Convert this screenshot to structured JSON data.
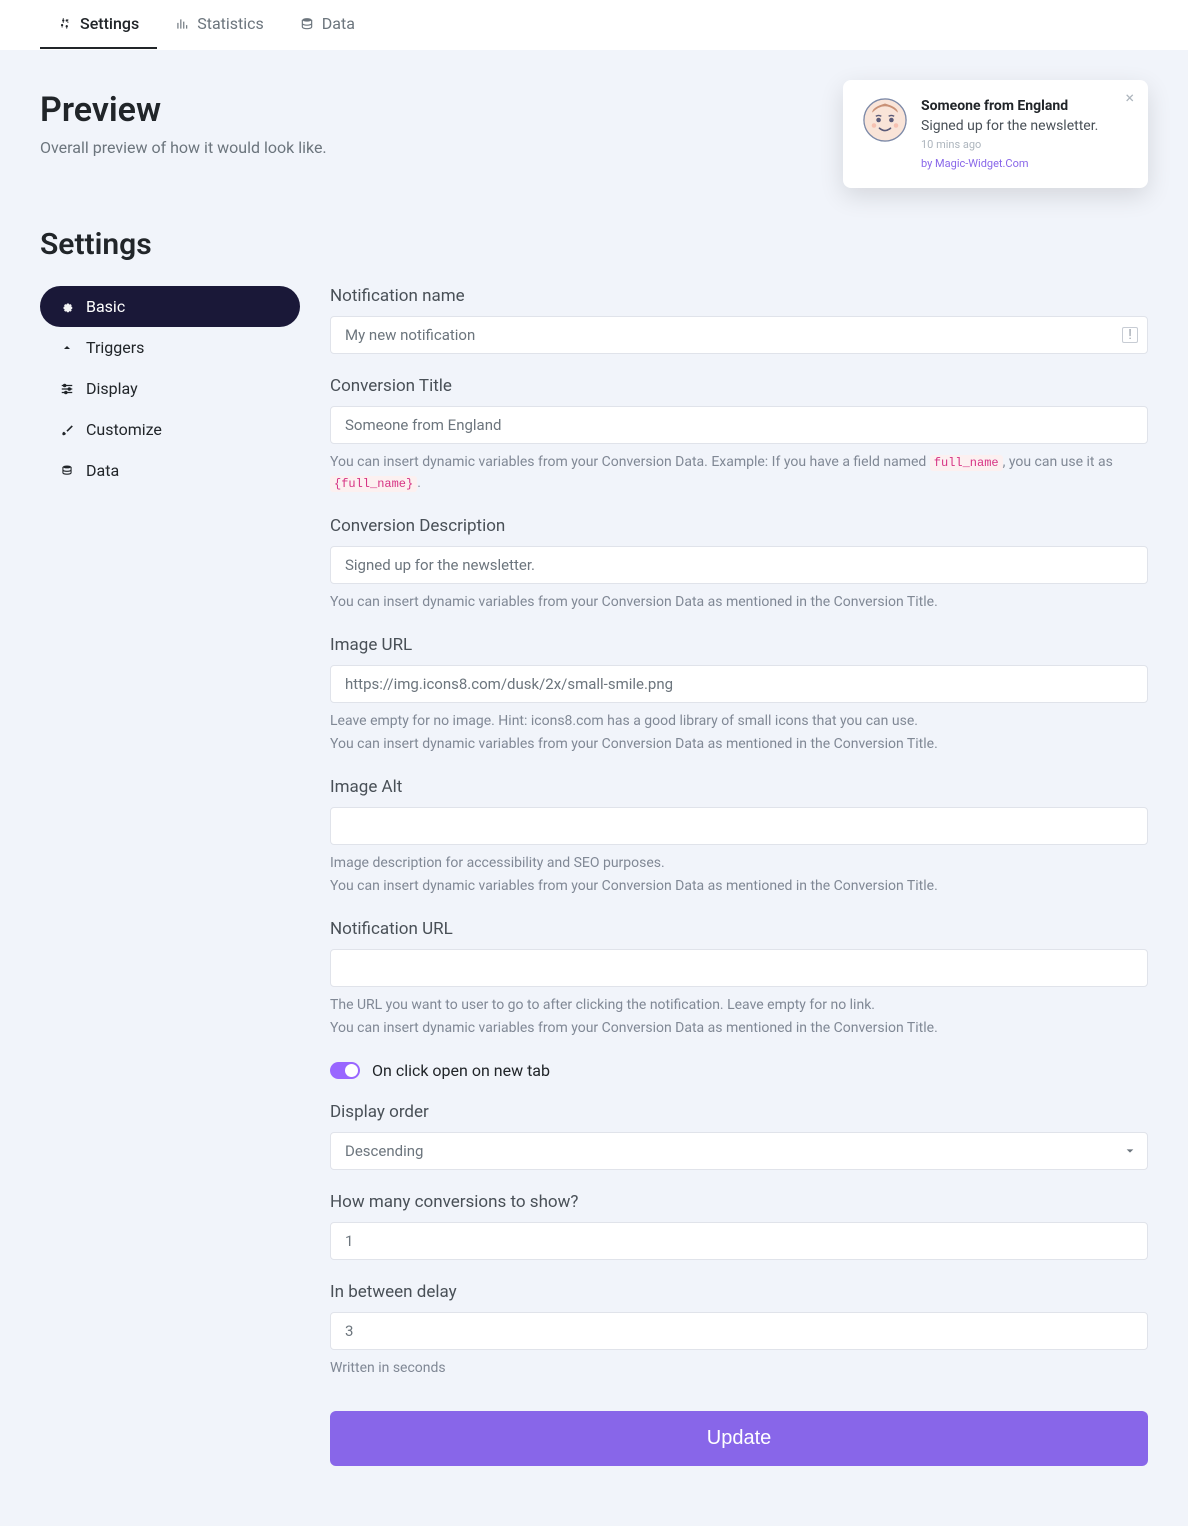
{
  "tabs": {
    "settings": "Settings",
    "statistics": "Statistics",
    "data": "Data"
  },
  "preview": {
    "title": "Preview",
    "subtitle": "Overall preview of how it would look like."
  },
  "toast": {
    "title": "Someone from England",
    "description": "Signed up for the newsletter.",
    "time": "10 mins ago",
    "credit": "by Magic-Widget.Com"
  },
  "settings": {
    "title": "Settings"
  },
  "side": {
    "basic": "Basic",
    "triggers": "Triggers",
    "display": "Display",
    "customize": "Customize",
    "data": "Data"
  },
  "form": {
    "notification_name": {
      "label": "Notification name",
      "value": "My new notification"
    },
    "conversion_title": {
      "label": "Conversion Title",
      "value": "Someone from England",
      "hint_prefix": "You can insert dynamic variables from your Conversion Data. Example: If you have a field named ",
      "hint_code1": "full_name",
      "hint_mid": ", you can use it as ",
      "hint_code2": "{full_name}",
      "hint_suffix": "."
    },
    "conversion_description": {
      "label": "Conversion Description",
      "value": "Signed up for the newsletter.",
      "hint": "You can insert dynamic variables from your Conversion Data as mentioned in the Conversion Title."
    },
    "image_url": {
      "label": "Image URL",
      "value": "https://img.icons8.com/dusk/2x/small-smile.png",
      "hint1": "Leave empty for no image. Hint: icons8.com has a good library of small icons that you can use.",
      "hint2": "You can insert dynamic variables from your Conversion Data as mentioned in the Conversion Title."
    },
    "image_alt": {
      "label": "Image Alt",
      "value": "",
      "hint1": "Image description for accessibility and SEO purposes.",
      "hint2": "You can insert dynamic variables from your Conversion Data as mentioned in the Conversion Title."
    },
    "notification_url": {
      "label": "Notification URL",
      "value": "",
      "hint1": "The URL you want to user to go to after clicking the notification. Leave empty for no link.",
      "hint2": "You can insert dynamic variables from your Conversion Data as mentioned in the Conversion Title."
    },
    "open_new_tab": {
      "label": "On click open on new tab"
    },
    "display_order": {
      "label": "Display order",
      "value": "Descending"
    },
    "conversions_count": {
      "label": "How many conversions to show?",
      "value": "1"
    },
    "between_delay": {
      "label": "In between delay",
      "value": "3",
      "hint": "Written in seconds"
    },
    "update": "Update"
  }
}
